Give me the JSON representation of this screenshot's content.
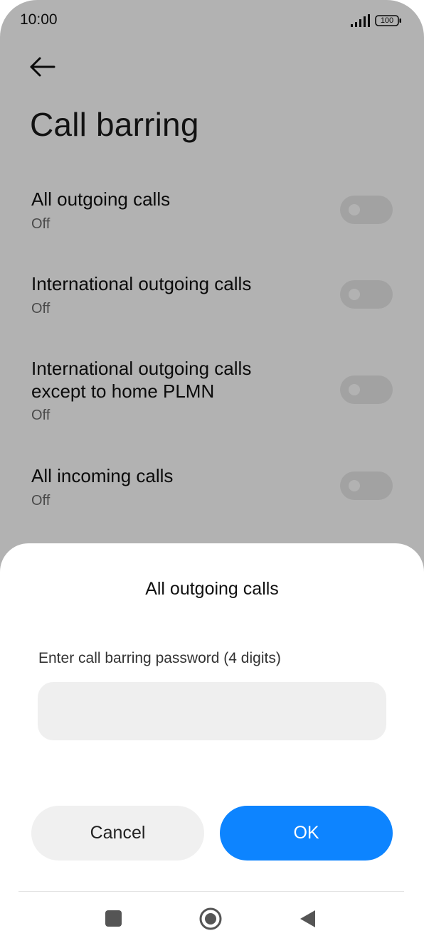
{
  "status_bar": {
    "time": "10:00",
    "battery": "100"
  },
  "page": {
    "title": "Call barring"
  },
  "settings": [
    {
      "title": "All outgoing calls",
      "status": "Off",
      "enabled": false
    },
    {
      "title": "International outgoing calls",
      "status": "Off",
      "enabled": false
    },
    {
      "title": "International outgoing calls except to home PLMN",
      "status": "Off",
      "enabled": false
    },
    {
      "title": "All incoming calls",
      "status": "Off",
      "enabled": false
    }
  ],
  "dialog": {
    "title": "All outgoing calls",
    "password_label": "Enter call barring password (4 digits)",
    "password_value": "",
    "cancel_label": "Cancel",
    "ok_label": "OK"
  },
  "colors": {
    "accent": "#0d84ff",
    "toggle_off": "#e9e9e9",
    "overlay": "rgba(0,0,0,0.30)"
  },
  "icons": {
    "back": "arrow-left-icon",
    "recents": "square-icon",
    "home": "circle-icon",
    "back_nav": "triangle-left-icon"
  }
}
